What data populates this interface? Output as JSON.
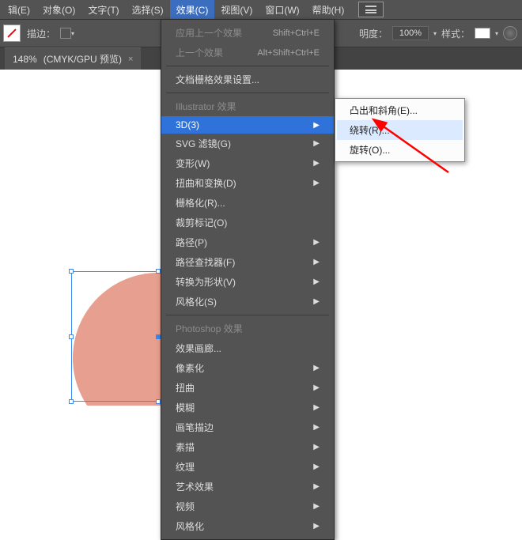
{
  "menubar": {
    "items": [
      {
        "label": "辑(E)"
      },
      {
        "label": "对象(O)"
      },
      {
        "label": "文字(T)"
      },
      {
        "label": "选择(S)"
      },
      {
        "label": "效果(C)"
      },
      {
        "label": "视图(V)"
      },
      {
        "label": "窗口(W)"
      },
      {
        "label": "帮助(H)"
      }
    ]
  },
  "toolbar": {
    "stroke_label": "描边：",
    "opacity_label": "明度：",
    "opacity_value": "100%",
    "style_label": "样式："
  },
  "tab": {
    "zoom": "148%",
    "mode": "(CMYK/GPU 预览)",
    "close": "×"
  },
  "menu": {
    "apply_last": {
      "label": "应用上一个效果",
      "shortcut": "Shift+Ctrl+E"
    },
    "last": {
      "label": "上一个效果",
      "shortcut": "Alt+Shift+Ctrl+E"
    },
    "doc_raster": "文档栅格效果设置...",
    "section_ai": "Illustrator 效果",
    "ai_items": [
      {
        "label": "3D(3)",
        "sub": true,
        "hover": true
      },
      {
        "label": "SVG 滤镜(G)",
        "sub": true
      },
      {
        "label": "变形(W)",
        "sub": true
      },
      {
        "label": "扭曲和变换(D)",
        "sub": true
      },
      {
        "label": "栅格化(R)..."
      },
      {
        "label": "裁剪标记(O)"
      },
      {
        "label": "路径(P)",
        "sub": true
      },
      {
        "label": "路径查找器(F)",
        "sub": true
      },
      {
        "label": "转换为形状(V)",
        "sub": true
      },
      {
        "label": "风格化(S)",
        "sub": true
      }
    ],
    "section_ps": "Photoshop 效果",
    "ps_items": [
      {
        "label": "效果画廊..."
      },
      {
        "label": "像素化",
        "sub": true
      },
      {
        "label": "扭曲",
        "sub": true
      },
      {
        "label": "模糊",
        "sub": true
      },
      {
        "label": "画笔描边",
        "sub": true
      },
      {
        "label": "素描",
        "sub": true
      },
      {
        "label": "纹理",
        "sub": true
      },
      {
        "label": "艺术效果",
        "sub": true
      },
      {
        "label": "视频",
        "sub": true
      },
      {
        "label": "风格化",
        "sub": true
      }
    ]
  },
  "submenu": {
    "items": [
      {
        "label": "凸出和斜角(E)..."
      },
      {
        "label": "绕转(R)...",
        "hover": true
      },
      {
        "label": "旋转(O)..."
      }
    ]
  }
}
